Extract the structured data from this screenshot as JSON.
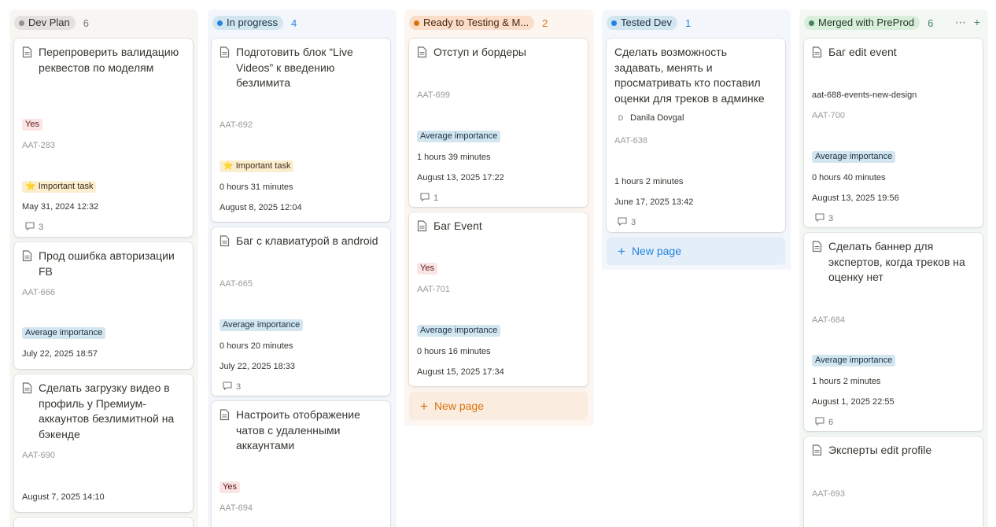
{
  "columns": [
    {
      "name": "Dev Plan",
      "count": "6"
    },
    {
      "name": "In progress",
      "count": "4"
    },
    {
      "name": "Ready to Testing & M...",
      "count": "2"
    },
    {
      "name": "Tested Dev",
      "count": "1"
    },
    {
      "name": "Merged with PreProd",
      "count": "6"
    }
  ],
  "new_page_label": "New page",
  "tags": {
    "yes": "Yes",
    "important": "⭐ Important task",
    "average": "Average importance"
  },
  "cards": {
    "c1": {
      "title": "Перепроверить валидацию реквестов по моделям",
      "id": "AAT-283",
      "date": "May 31, 2024 12:32",
      "comments": "3"
    },
    "c2": {
      "title": "Прод ошибка авторизации FB",
      "id": "AAT-666",
      "date": "July 22, 2025 18:57"
    },
    "c3": {
      "title": "Сделать загрузку видео в профиль у Премиум-аккаунтов безлимитной на бэкенде",
      "id": "AAT-690",
      "date": "August 7, 2025 14:10"
    },
    "c4": {
      "title": "Подготовить блок “Live Videos” к введению безлимита",
      "id": "AAT-692",
      "duration": "0 hours 31 minutes",
      "date": "August 8, 2025 12:04"
    },
    "c5": {
      "title": "Баг с клавиатурой в android",
      "id": "AAT-665",
      "duration": "0 hours 20 minutes",
      "date": "July 22, 2025 18:33",
      "comments": "3"
    },
    "c6": {
      "title": "Настроить отображение чатов с удаленными аккаунтами",
      "id": "AAT-694"
    },
    "c7": {
      "title": "Отступ и бордеры",
      "id": "AAT-699",
      "duration": "1 hours 39 minutes",
      "date": "August 13, 2025 17:22",
      "comments": "1"
    },
    "c8": {
      "title": "Баг Event",
      "id": "AAT-701",
      "duration": "0 hours 16 minutes",
      "date": "August 15, 2025 17:34"
    },
    "c9": {
      "title": "Сделать возможность задавать, менять и просматривать кто поставил оценки для треков в админке",
      "person": "Danila Dovgal",
      "person_initial": "D",
      "id": "AAT-638",
      "duration": "1 hours 2 minutes",
      "date": "June 17, 2025 13:42",
      "comments": "3"
    },
    "c10": {
      "title": "Баг edit event",
      "branch": "aat-688-events-new-design",
      "id": "AAT-700",
      "duration": "0 hours 40 minutes",
      "date": "August 13, 2025 19:56",
      "comments": "3"
    },
    "c11": {
      "title": "Сделать баннер для экспертов, когда треков на оценку нет",
      "id": "AAT-684",
      "duration": "1 hours 2 minutes",
      "date": "August 1, 2025 22:55",
      "comments": "6"
    },
    "c12": {
      "title": "Эксперты edit profile",
      "id": "AAT-693"
    }
  }
}
